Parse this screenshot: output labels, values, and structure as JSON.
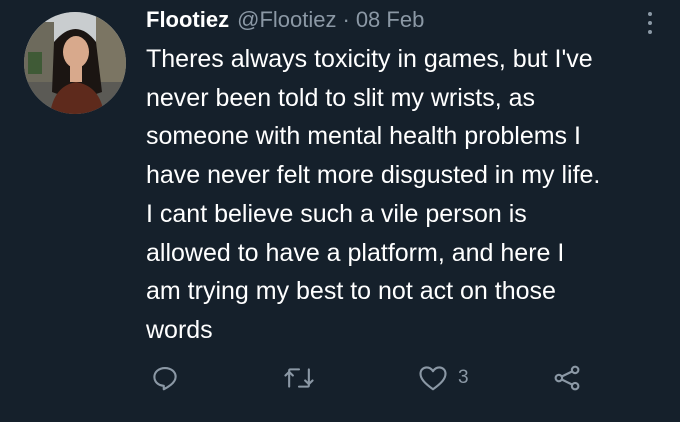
{
  "tweet": {
    "author_name": "Flootiez",
    "author_handle": "@Flootiez",
    "separator": "·",
    "date": "08 Feb",
    "text_lines": [
      "Theres always toxicity in games, but I've",
      "never been told to slit my wrists, as",
      "someone with mental health problems I",
      "have never felt more disgusted in my life.",
      "I cant believe such a vile person is",
      "allowed to have a platform, and here I",
      "am trying my best to not act on those",
      "words"
    ],
    "like_count": "3"
  },
  "icons": {
    "avatar": "profile-photo",
    "more": "more-vertical-icon",
    "reply": "reply-icon",
    "retweet": "retweet-icon",
    "like": "heart-icon",
    "share": "share-icon"
  },
  "colors": {
    "background": "#15202b",
    "text": "#ffffff",
    "secondary": "#8b98a5"
  }
}
